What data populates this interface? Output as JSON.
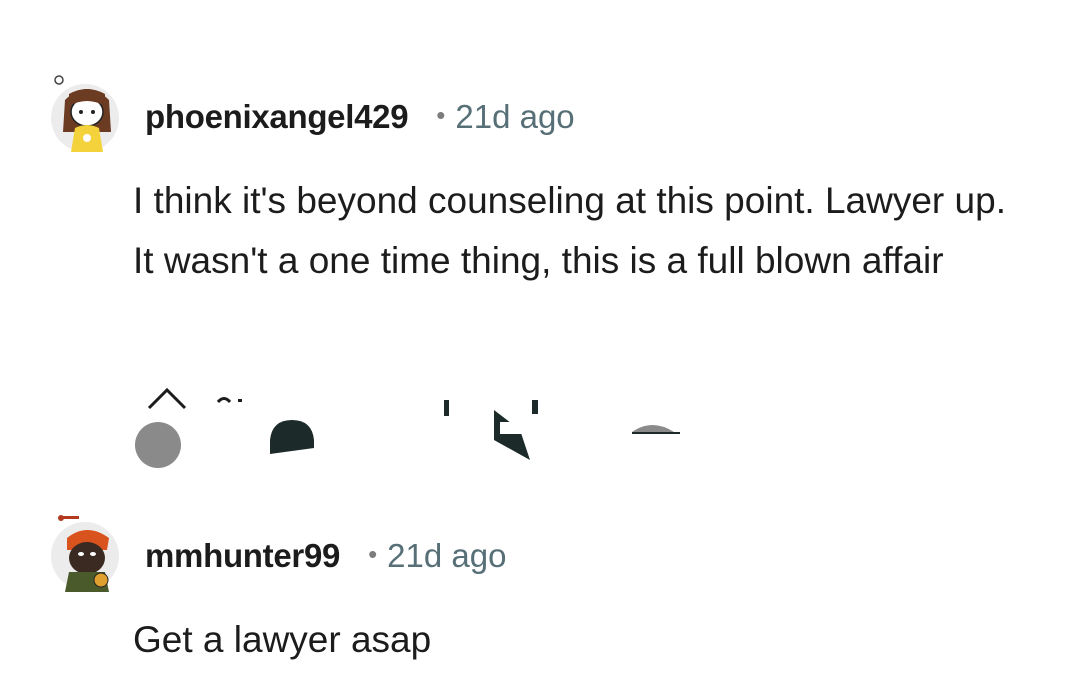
{
  "comments": [
    {
      "username": "phoenixangel429",
      "separator": "•",
      "age": "21d ago",
      "body": "I think it's beyond counseling at this point. Lawyer up. It wasn't a one time thing, this is a full blown affair",
      "avatar_icon": "snoo-avatar-girl-icon"
    },
    {
      "username": "mmhunter99",
      "separator": "•",
      "age": "21d ago",
      "body": "Get a lawyer asap",
      "avatar_icon": "snoo-avatar-hunter-icon"
    }
  ],
  "action_icons": {
    "upvote": "upvote-icon",
    "vote_state": "vote-indicator-icon",
    "reply": "reply-icon",
    "award": "award-icon",
    "more": "more-options-icon"
  },
  "colors": {
    "text": "#1c1c1c",
    "meta": "#576f76",
    "icon_dark": "#1c2a2a",
    "icon_gray": "#8a8a8a"
  }
}
